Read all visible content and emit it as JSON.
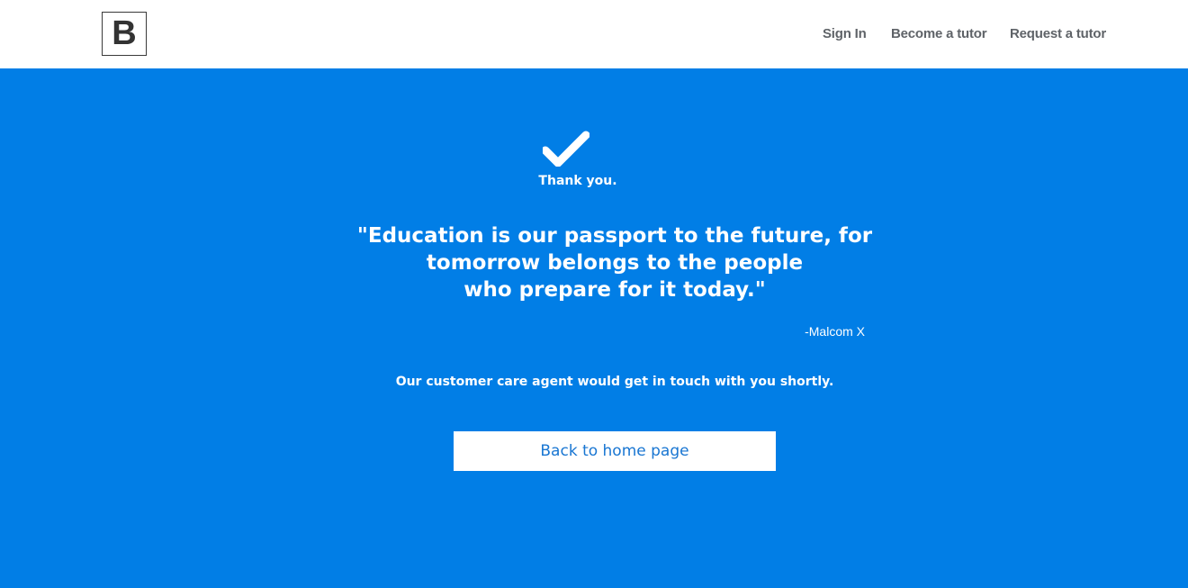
{
  "header": {
    "logo_text": "B",
    "nav": [
      {
        "label": "Sign In"
      },
      {
        "label": "Become a tutor"
      },
      {
        "label": "Request a tutor"
      }
    ]
  },
  "hero": {
    "icon": "checkmark-icon",
    "thanks": "Thank you.",
    "quote_lines": [
      "\"Education is our passport to the future, for",
      "tomorrow belongs to the people",
      "who prepare for it today.\""
    ],
    "author": "-Malcom X",
    "message": "Our customer care agent would get in touch with you shortly.",
    "button_label": "Back to home page"
  },
  "colors": {
    "hero_background": "#017ee6",
    "button_text": "#1976d2",
    "nav_text": "#5f6368"
  }
}
